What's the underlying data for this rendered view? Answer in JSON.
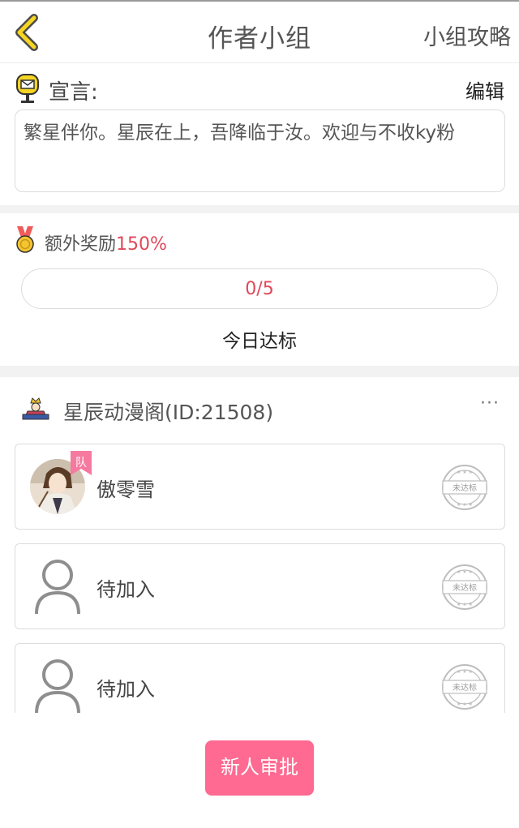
{
  "header": {
    "title": "作者小组",
    "guide_label": "小组攻略",
    "back_icon": "chevron-left-icon"
  },
  "declaration": {
    "label": "宣言:",
    "edit_label": "编辑",
    "text": "繁星伴你。星辰在上，吾降临于汝。欢迎与不收ky粉",
    "icon": "mailbox-icon"
  },
  "reward": {
    "label_prefix": "额外奖励",
    "percent": "150%",
    "progress_text": "0/5",
    "progress_value": 0,
    "status": "今日达标",
    "icon": "medal-icon"
  },
  "group": {
    "name": "星辰动漫阁(ID:21508)",
    "more_label": "···",
    "icon": "group-crown-icon"
  },
  "members": [
    {
      "name": "傲零雪",
      "badge": "队",
      "stamp": "未达标",
      "has_avatar": true
    },
    {
      "name": "待加入",
      "stamp": "未达标",
      "has_avatar": false
    },
    {
      "name": "待加入",
      "stamp": "未达标",
      "has_avatar": false
    }
  ],
  "footer": {
    "approve_label": "新人审批"
  },
  "colors": {
    "accent_pink": "#fe6a91",
    "reward_red": "#e0485a",
    "back_yellow": "#f5d423"
  }
}
